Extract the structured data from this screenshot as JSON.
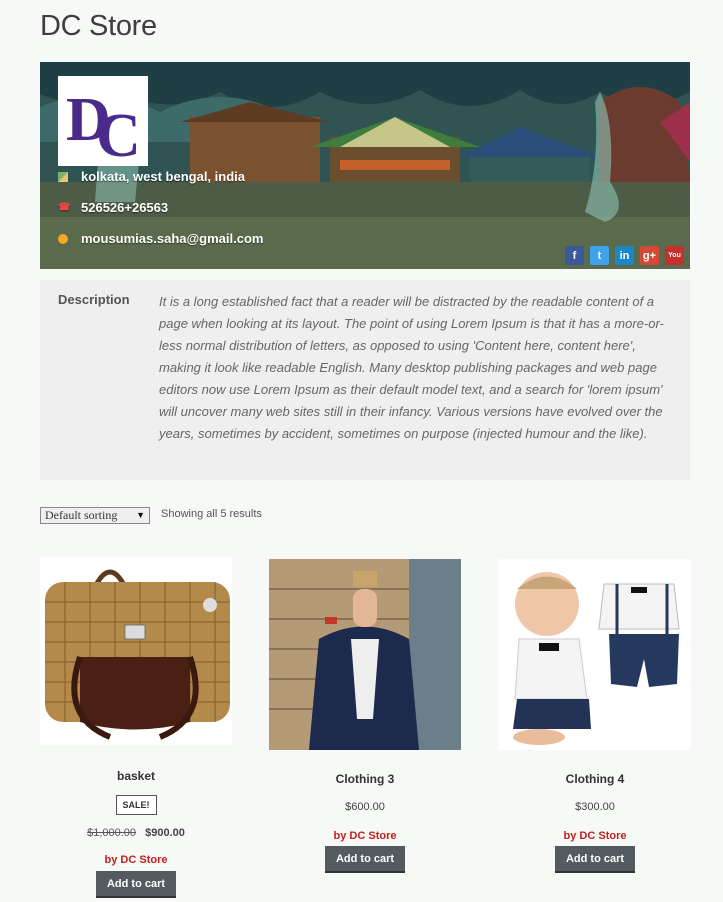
{
  "store": {
    "title": "DC Store",
    "logo_text": "DC",
    "location": "kolkata, west bengal, india",
    "phone": "526526+26563",
    "email": "mousumias.saha@gmail.com",
    "social": [
      {
        "name": "facebook",
        "glyph": "f",
        "color": "#3b5998"
      },
      {
        "name": "twitter",
        "glyph": "t",
        "color": "#3ea1ec"
      },
      {
        "name": "linkedin",
        "glyph": "in",
        "color": "#1c86c6"
      },
      {
        "name": "google-plus",
        "glyph": "g+",
        "color": "#d34836"
      },
      {
        "name": "youtube",
        "glyph": "You",
        "color": "#c4302b"
      }
    ]
  },
  "description": {
    "label": "Description",
    "text": "It is a long established fact that a reader will be distracted by the readable content of a page when looking at its layout. The point of using Lorem Ipsum is that it has a more-or-less normal distribution of letters, as opposed to using 'Content here, content here', making it look like readable English. Many desktop publishing packages and web page editors now use Lorem Ipsum as their default model text, and a search for 'lorem ipsum' will uncover many web sites still in their infancy. Various versions have evolved over the years, sometimes by accident, sometimes on purpose (injected humour and the like)."
  },
  "toolbar": {
    "sorting": "Default sorting",
    "results": "Showing all 5 results"
  },
  "products": [
    {
      "name": "basket",
      "sale_badge": "SALE!",
      "old_price": "$1,000.00",
      "price": "$900.00",
      "vendor": "by DC Store",
      "button": "Add to cart"
    },
    {
      "name": "Clothing 3",
      "price": "$600.00",
      "vendor": "by DC Store",
      "button": "Add to cart"
    },
    {
      "name": "Clothing 4",
      "price": "$300.00",
      "vendor": "by DC Store",
      "button": "Add to cart"
    }
  ]
}
